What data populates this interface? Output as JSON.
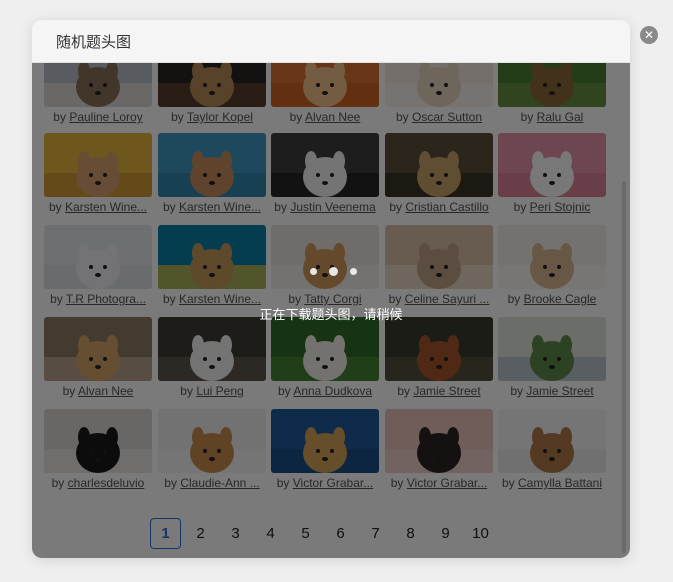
{
  "dialog": {
    "title": "随机题头图",
    "close_icon": "close-circle-icon"
  },
  "loading": {
    "text": "正在下载题头图，请稍候"
  },
  "credit_prefix": "by",
  "photos": [
    {
      "author": "Pauline Loroy",
      "tones": [
        "#b9c1c9",
        "#8b6f58",
        "#e9e4de"
      ]
    },
    {
      "author": "Taylor Kopel",
      "tones": [
        "#2a2424",
        "#b98a56",
        "#6b4a35"
      ]
    },
    {
      "author": "Alvan Nee",
      "tones": [
        "#d9712e",
        "#f0c08a",
        "#c85f20"
      ]
    },
    {
      "author": "Oscar Sutton",
      "tones": [
        "#f3e9df",
        "#e7d3be",
        "#f8f3ee"
      ]
    },
    {
      "author": "Ralu Gal",
      "tones": [
        "#4f7d35",
        "#8a6a3c",
        "#6f9a48"
      ]
    },
    {
      "author": "Karsten Wine...",
      "tones": [
        "#e5b63c",
        "#d7a170",
        "#c9902f"
      ]
    },
    {
      "author": "Karsten Wine...",
      "tones": [
        "#3f9ac1",
        "#c98d5c",
        "#2f7ea5"
      ]
    },
    {
      "author": "Justin Veenema",
      "tones": [
        "#3e3e3e",
        "#f2f2f2",
        "#1c1c1c"
      ]
    },
    {
      "author": "Cristian Castillo",
      "tones": [
        "#5a4f3a",
        "#c9a36a",
        "#2e2a20"
      ]
    },
    {
      "author": "Peri Stojnic",
      "tones": [
        "#e793a8",
        "#fbfbfb",
        "#d77a92"
      ]
    },
    {
      "author": "T.R Photogra...",
      "tones": [
        "#e6e8ee",
        "#f1f1f4",
        "#d9dce4"
      ]
    },
    {
      "author": "Karsten Wine...",
      "tones": [
        "#0c7fa8",
        "#c79a5a",
        "#f0c43a"
      ]
    },
    {
      "author": "Tatty Corgi",
      "tones": [
        "#e8e2dc",
        "#d49a5c",
        "#f6f3ef"
      ]
    },
    {
      "author": "Celine Sayuri ...",
      "tones": [
        "#d8c1a6",
        "#bfa284",
        "#efe1cf"
      ]
    },
    {
      "author": "Brooke Cagle",
      "tones": [
        "#f0eeea",
        "#d6b98f",
        "#fbfaf8"
      ]
    },
    {
      "author": "Alvan Nee",
      "tones": [
        "#8f7b65",
        "#d6a36a",
        "#c9b49b"
      ]
    },
    {
      "author": "Lui Peng",
      "tones": [
        "#3e3b36",
        "#f2f2f2",
        "#6b6358"
      ]
    },
    {
      "author": "Anna Dudkova",
      "tones": [
        "#2f6b2a",
        "#f2efe8",
        "#4c8f3c"
      ]
    },
    {
      "author": "Jamie Street",
      "tones": [
        "#3a3b2e",
        "#a8562a",
        "#5d5a44"
      ]
    },
    {
      "author": "Jamie Street",
      "tones": [
        "#dfe3dc",
        "#5f8a4a",
        "#a9b8c4"
      ]
    },
    {
      "author": "charlesdeluvio",
      "tones": [
        "#d9d7d3",
        "#1d1a1a",
        "#eeecea"
      ]
    },
    {
      "author": "Claudie-Ann ...",
      "tones": [
        "#efeff1",
        "#c98d4e",
        "#f7f7f8"
      ]
    },
    {
      "author": "Victor Grabar...",
      "tones": [
        "#1f5c9c",
        "#d6a35a",
        "#184a80"
      ]
    },
    {
      "author": "Victor Grabar...",
      "tones": [
        "#e7c2b8",
        "#2b2422",
        "#f1d6cf"
      ]
    },
    {
      "author": "Camylla Battani",
      "tones": [
        "#f4f4f4",
        "#b07a4a",
        "#e6e6e6"
      ]
    }
  ],
  "pagination": {
    "pages": [
      "1",
      "2",
      "3",
      "4",
      "5",
      "6",
      "7",
      "8",
      "9",
      "10"
    ],
    "current": "1"
  }
}
